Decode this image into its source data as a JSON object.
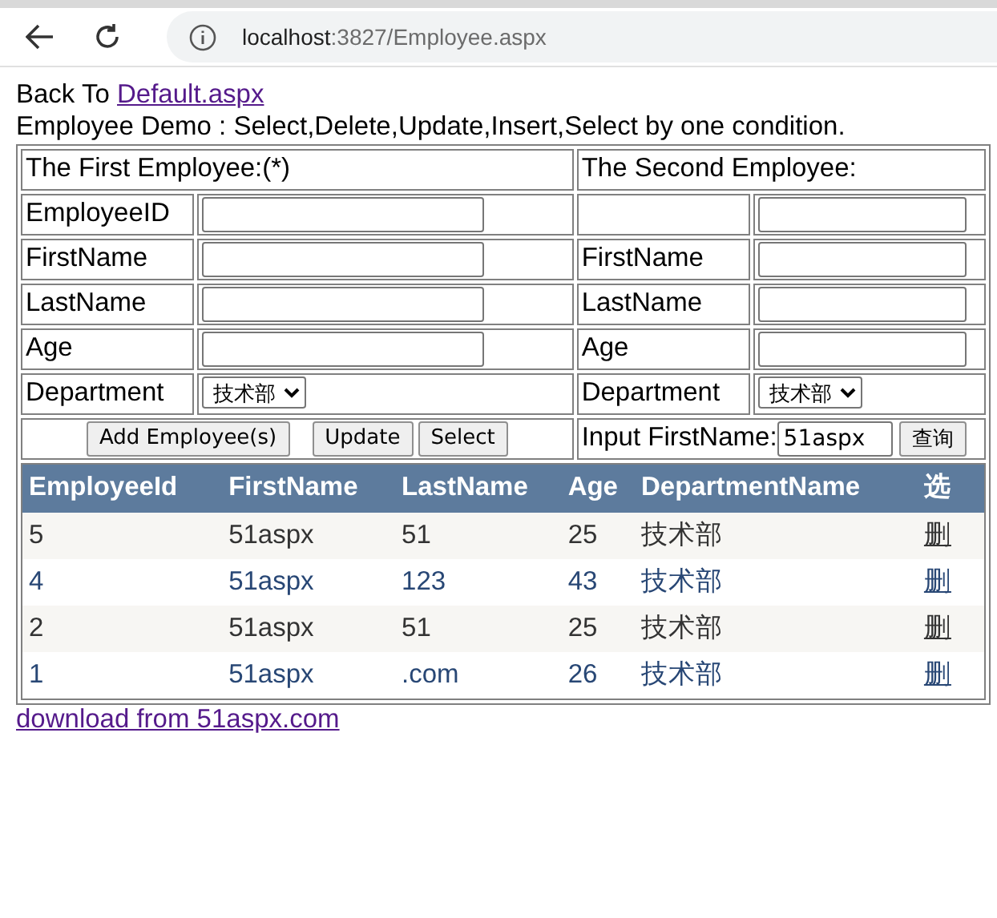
{
  "browser": {
    "host": "localhost",
    "path": ":3827/Employee.aspx"
  },
  "back_link": {
    "prefix": "Back To",
    "link": "Default.aspx"
  },
  "heading": "Employee Demo : Select,Delete,Update,Insert,Select by one condition.",
  "first_employee": {
    "title": "The First Employee:(*)",
    "fields": [
      {
        "label": "EmployeeID",
        "kind": "text"
      },
      {
        "label": "FirstName",
        "kind": "text"
      },
      {
        "label": "LastName",
        "kind": "text"
      },
      {
        "label": "Age",
        "kind": "text"
      },
      {
        "label": "Department",
        "kind": "select",
        "value": "技术部"
      }
    ],
    "buttons": [
      "Add Employee(s)",
      "Update",
      "Select"
    ]
  },
  "second_employee": {
    "title": "The Second Employee:",
    "fields": [
      {
        "kind": "text"
      },
      {
        "label": "FirstName",
        "kind": "text"
      },
      {
        "label": "LastName",
        "kind": "text"
      },
      {
        "label": "Age",
        "kind": "text"
      },
      {
        "label": "Department",
        "kind": "select",
        "value": "技术部"
      }
    ]
  },
  "search": {
    "label": "Input FirstName:",
    "value": "51aspx",
    "button": "查询"
  },
  "grid": {
    "columns": [
      "EmployeeId",
      "FirstName",
      "LastName",
      "Age",
      "DepartmentName",
      "选"
    ],
    "rows": [
      {
        "cells": [
          "5",
          "51aspx",
          "51",
          "25",
          "技术部"
        ],
        "action": "删"
      },
      {
        "cells": [
          "4",
          "51aspx",
          "123",
          "43",
          "技术部"
        ],
        "action": "删"
      },
      {
        "cells": [
          "2",
          "51aspx",
          "51",
          "25",
          "技术部"
        ],
        "action": "删"
      },
      {
        "cells": [
          "1",
          "51aspx",
          ".com",
          "26",
          "技术部"
        ],
        "action": "删"
      }
    ]
  },
  "footer_link": "download from 51aspx.com"
}
